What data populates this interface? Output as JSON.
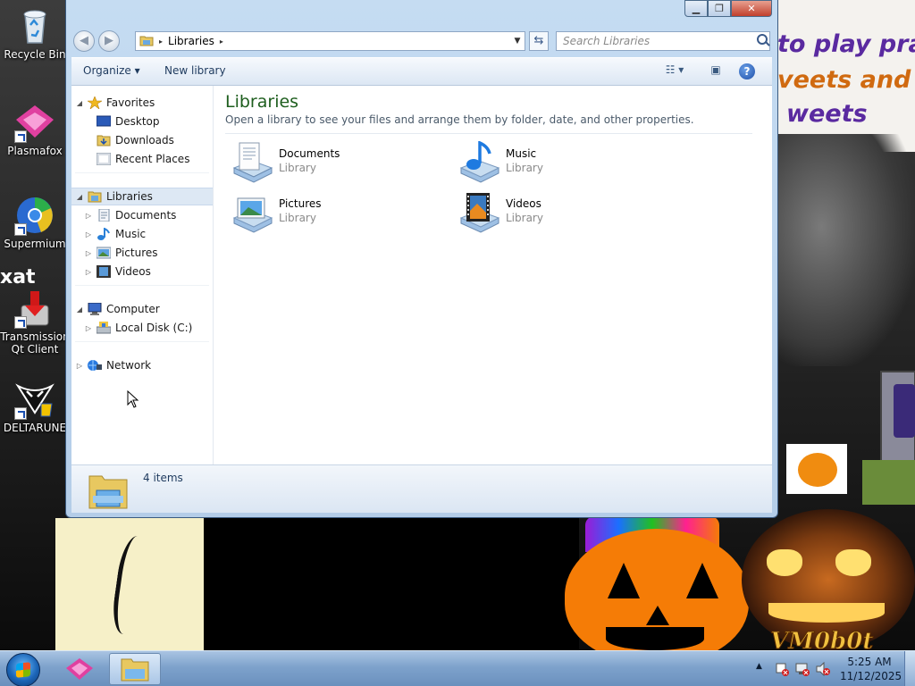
{
  "desktop": {
    "icons": [
      {
        "label": "Recycle Bin",
        "icon": "recycle-bin-icon"
      },
      {
        "label": "Plasmafox",
        "icon": "plasmafox-icon"
      },
      {
        "label": "Supermium",
        "icon": "supermium-icon"
      },
      {
        "label": "Transmission Qt Client",
        "icon": "transmission-icon"
      },
      {
        "label": "DELTARUNE",
        "icon": "deltarune-icon"
      }
    ],
    "wallpaper": {
      "line1": "to play pra",
      "line2": "veets and i",
      "line3": "weets",
      "signature": "VM0b0t",
      "partial_text": "xat"
    }
  },
  "window": {
    "caption_buttons": {
      "minimize": "▁",
      "maximize": "❐",
      "close": "✕"
    },
    "address": {
      "crumb_root_icon": "libraries-folder-icon",
      "crumb": "Libraries",
      "separator": "▸"
    },
    "search_placeholder": "Search Libraries",
    "toolbar": {
      "organize": "Organize ▾",
      "new_library": "New library"
    },
    "nav": {
      "favorites": {
        "label": "Favorites",
        "items": [
          "Desktop",
          "Downloads",
          "Recent Places"
        ]
      },
      "libraries": {
        "label": "Libraries",
        "items": [
          "Documents",
          "Music",
          "Pictures",
          "Videos"
        ]
      },
      "computer": {
        "label": "Computer",
        "items": [
          "Local Disk (C:)"
        ]
      },
      "network": {
        "label": "Network"
      }
    },
    "main": {
      "title": "Libraries",
      "description": "Open a library to see your files and arrange them by folder, date, and other properties.",
      "libraries": [
        {
          "name": "Documents",
          "type": "Library",
          "icon": "documents-library-icon"
        },
        {
          "name": "Music",
          "type": "Library",
          "icon": "music-library-icon"
        },
        {
          "name": "Pictures",
          "type": "Library",
          "icon": "pictures-library-icon"
        },
        {
          "name": "Videos",
          "type": "Library",
          "icon": "videos-library-icon"
        }
      ]
    },
    "status": {
      "count": "4 items"
    }
  },
  "taskbar": {
    "clock_time": "5:25 AM",
    "clock_date": "11/12/2025",
    "tray_expand": "▲"
  },
  "colors": {
    "library_title": "#1e5e1e",
    "window_frame": "#c5dcf2",
    "taskbar": "#7ea2cc"
  }
}
